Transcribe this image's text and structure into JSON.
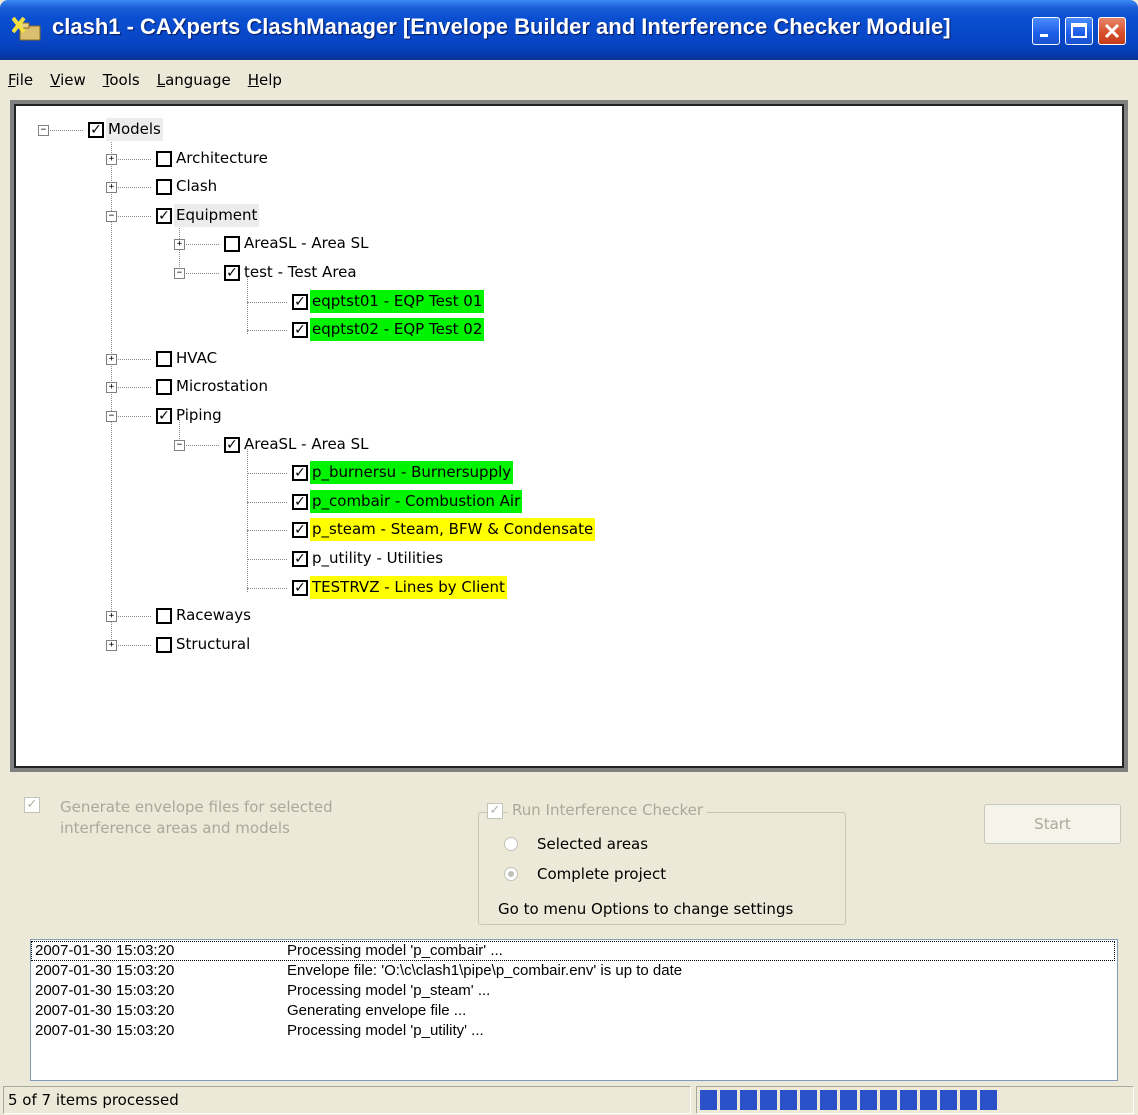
{
  "window": {
    "title": "clash1 - CAXperts ClashManager [Envelope Builder and Interference Checker Module]"
  },
  "menu": [
    {
      "key": "F",
      "rest": "ile"
    },
    {
      "key": "V",
      "rest": "iew"
    },
    {
      "key": "T",
      "rest": "ools"
    },
    {
      "key": "L",
      "rest": "anguage"
    },
    {
      "key": "H",
      "rest": "elp"
    }
  ],
  "tree": {
    "nodes": [
      {
        "label": "Models",
        "checked": true,
        "expanded": true,
        "level": 0,
        "highlight": "gray"
      },
      {
        "label": "Architecture",
        "checked": false,
        "expanded": false,
        "level": 1
      },
      {
        "label": "Clash",
        "checked": false,
        "expanded": false,
        "level": 1
      },
      {
        "label": "Equipment",
        "checked": true,
        "expanded": true,
        "level": 1,
        "highlight": "gray"
      },
      {
        "label": "AreaSL - Area SL",
        "checked": false,
        "expanded": false,
        "level": 2
      },
      {
        "label": "test - Test Area",
        "checked": true,
        "expanded": true,
        "level": 2
      },
      {
        "label": "eqptst01 - EQP Test 01",
        "checked": true,
        "level": 3,
        "highlight": "green"
      },
      {
        "label": "eqptst02 - EQP Test 02",
        "checked": true,
        "level": 3,
        "highlight": "green"
      },
      {
        "label": "HVAC",
        "checked": false,
        "expanded": false,
        "level": 1
      },
      {
        "label": "Microstation",
        "checked": false,
        "expanded": false,
        "level": 1
      },
      {
        "label": "Piping",
        "checked": true,
        "expanded": true,
        "level": 1
      },
      {
        "label": "AreaSL - Area SL",
        "checked": true,
        "expanded": true,
        "level": 2
      },
      {
        "label": "p_burnersu - Burnersupply",
        "checked": true,
        "level": 3,
        "highlight": "green"
      },
      {
        "label": "p_combair - Combustion Air",
        "checked": true,
        "level": 3,
        "highlight": "green"
      },
      {
        "label": "p_steam - Steam, BFW & Condensate",
        "checked": true,
        "level": 3,
        "highlight": "yellow"
      },
      {
        "label": "p_utility - Utilities",
        "checked": true,
        "level": 3
      },
      {
        "label": "TESTRVZ - Lines by Client",
        "checked": true,
        "level": 3,
        "highlight": "yellow"
      },
      {
        "label": "Raceways",
        "checked": false,
        "expanded": false,
        "level": 1
      },
      {
        "label": "Structural",
        "checked": false,
        "expanded": false,
        "level": 1
      }
    ]
  },
  "options": {
    "generate_line1": "Generate envelope files for selected",
    "generate_line2": "interference areas and models",
    "run_checker": "Run Interference Checker",
    "radio_selected_areas": "Selected areas",
    "radio_complete_project": "Complete project",
    "hint": "Go to menu Options to change settings",
    "start": "Start"
  },
  "log": [
    {
      "time": "2007-01-30 15:03:20",
      "message": "Processing model 'p_combair' ..."
    },
    {
      "time": "2007-01-30 15:03:20",
      "message": "Envelope file: 'O:\\c\\clash1\\pipe\\p_combair.env' is up to date"
    },
    {
      "time": "2007-01-30 15:03:20",
      "message": "Processing model 'p_steam' ..."
    },
    {
      "time": "2007-01-30 15:03:20",
      "message": "Generating envelope file ..."
    },
    {
      "time": "2007-01-30 15:03:20",
      "message": "Processing model 'p_utility' ..."
    }
  ],
  "status": {
    "text": "5 of 7 items processed",
    "progress_fraction": 0.75
  },
  "colors": {
    "done": "#00f300",
    "in_progress": "#ffff00",
    "progress": "#2a51c7"
  }
}
